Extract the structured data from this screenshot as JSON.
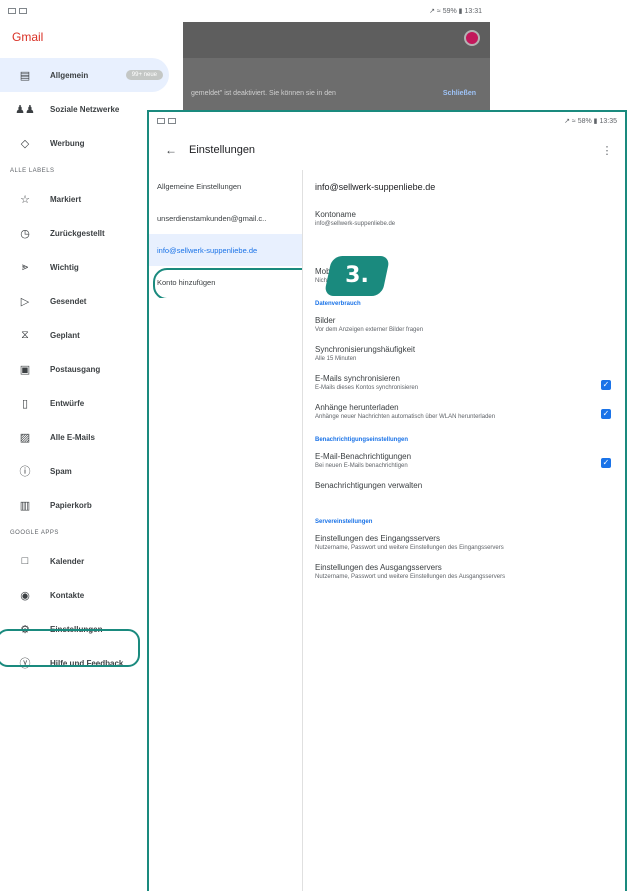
{
  "back": {
    "status_right": "↗ ≈ 59% ▮ 13:31",
    "drawer_title": "Gmail",
    "dim_text": "gemeldet\" ist deaktiviert. Sie können sie in den",
    "dim_action": "Schließen",
    "items_top": [
      {
        "label": "Allgemein",
        "icon": "inbox-icon",
        "glyph": "▤",
        "active": true,
        "badge": "99+ neue"
      },
      {
        "label": "Soziale Netzwerke",
        "icon": "people-icon",
        "glyph": "♟♟"
      },
      {
        "label": "Werbung",
        "icon": "tag-icon",
        "glyph": "◇"
      }
    ],
    "labels_header": "ALLE LABELS",
    "items_labels": [
      {
        "label": "Markiert",
        "icon": "star-icon",
        "glyph": "☆"
      },
      {
        "label": "Zurückgestellt",
        "icon": "clock-icon",
        "glyph": "◷"
      },
      {
        "label": "Wichtig",
        "icon": "important-icon",
        "glyph": "⪢"
      },
      {
        "label": "Gesendet",
        "icon": "send-icon",
        "glyph": "▷"
      },
      {
        "label": "Geplant",
        "icon": "scheduled-icon",
        "glyph": "⧖"
      },
      {
        "label": "Postausgang",
        "icon": "outbox-icon",
        "glyph": "▣"
      },
      {
        "label": "Entwürfe",
        "icon": "draft-icon",
        "glyph": "▯"
      },
      {
        "label": "Alle E-Mails",
        "icon": "all-mail-icon",
        "glyph": "▨"
      },
      {
        "label": "Spam",
        "icon": "spam-icon",
        "glyph": "ⓘ"
      },
      {
        "label": "Papierkorb",
        "icon": "trash-icon",
        "glyph": "▥"
      }
    ],
    "apps_header": "GOOGLE APPS",
    "items_apps": [
      {
        "label": "Kalender",
        "icon": "calendar-icon",
        "glyph": "□"
      },
      {
        "label": "Kontakte",
        "icon": "contacts-icon",
        "glyph": "◉"
      }
    ],
    "items_bottom": [
      {
        "label": "Einstellungen",
        "icon": "gear-icon",
        "glyph": "⚙"
      },
      {
        "label": "Hilfe und Feedback",
        "icon": "help-icon",
        "glyph": "ⓨ"
      }
    ]
  },
  "front": {
    "status_right": "↗ ≈ 58% ▮ 13:35",
    "title": "Einstellungen",
    "accounts": [
      {
        "label": "Allgemeine Einstellungen"
      },
      {
        "label": "unserdienstamkunden@gmail.c.."
      },
      {
        "label": "info@sellwerk-suppenliebe.de",
        "selected": true
      },
      {
        "label": "Konto hinzufügen",
        "add": true
      }
    ],
    "step": "3.",
    "account_email": "info@sellwerk-suppenliebe.de",
    "settings": [
      {
        "type": "item",
        "title": "Kontoname",
        "sub": "info@sellwerk-suppenliebe.de"
      },
      {
        "type": "spacer"
      },
      {
        "type": "item",
        "title": "Mobile Signatur",
        "sub": "Nicht festgelegt"
      },
      {
        "type": "section",
        "title": "Datenverbrauch"
      },
      {
        "type": "item",
        "title": "Bilder",
        "sub": "Vor dem Anzeigen externer Bilder fragen"
      },
      {
        "type": "item",
        "title": "Synchronisierungshäufigkeit",
        "sub": "Alle 15 Minuten"
      },
      {
        "type": "item",
        "title": "E-Mails synchronisieren",
        "sub": "E-Mails dieses Kontos synchronisieren",
        "checked": true
      },
      {
        "type": "item",
        "title": "Anhänge herunterladen",
        "sub": "Anhänge neuer Nachrichten automatisch über WLAN herunterladen",
        "checked": true
      },
      {
        "type": "section",
        "title": "Benachrichtigungseinstellungen"
      },
      {
        "type": "item",
        "title": "E-Mail-Benachrichtigungen",
        "sub": "Bei neuen E-Mails benachrichtigen",
        "checked": true
      },
      {
        "type": "item",
        "title": "Benachrichtigungen verwalten",
        "sub": ""
      },
      {
        "type": "section",
        "title": "Servereinstellungen"
      },
      {
        "type": "item",
        "title": "Einstellungen des Eingangsservers",
        "sub": "Nutzername, Passwort und weitere Einstellungen des Eingangsservers"
      },
      {
        "type": "item",
        "title": "Einstellungen des Ausgangsservers",
        "sub": "Nutzername, Passwort und weitere Einstellungen des Ausgangsservers"
      }
    ]
  },
  "colors": {
    "accent": "#1a8a7e",
    "gmail_red": "#d93025",
    "link_blue": "#1a73e8"
  }
}
